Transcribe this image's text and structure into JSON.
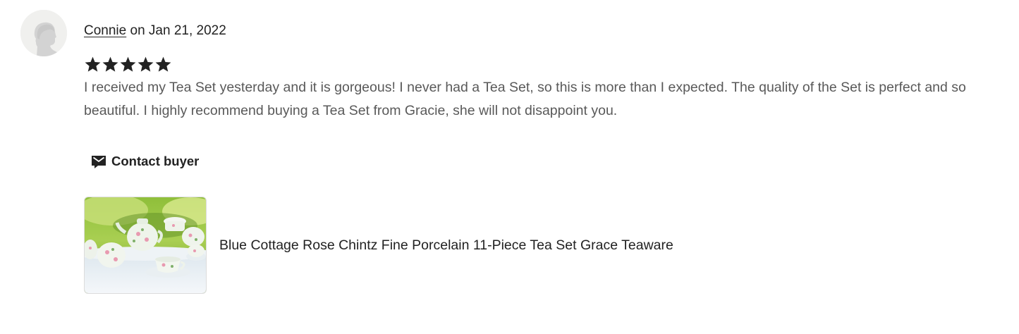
{
  "review": {
    "reviewer_name": "Connie",
    "date_prefix": " on ",
    "date": "Jan 21, 2022",
    "rating": 5,
    "rating_max": 5,
    "text": "I received my Tea Set yesterday and it is gorgeous! I never had a Tea Set, so this is more than I expected. The quality of the Set is perfect and so beautiful. I highly recommend buying a Tea Set from Gracie, she will not disappoint you."
  },
  "actions": {
    "contact_label": "Contact buyer",
    "contact_icon": "mail-icon"
  },
  "listing": {
    "title": "Blue Cottage Rose Chintz Fine Porcelain 11-Piece Tea Set Grace Teaware"
  },
  "colors": {
    "star": "#222222",
    "body_text": "#595959",
    "heading_text": "#222222",
    "avatar_bg": "#f0f0ee"
  }
}
